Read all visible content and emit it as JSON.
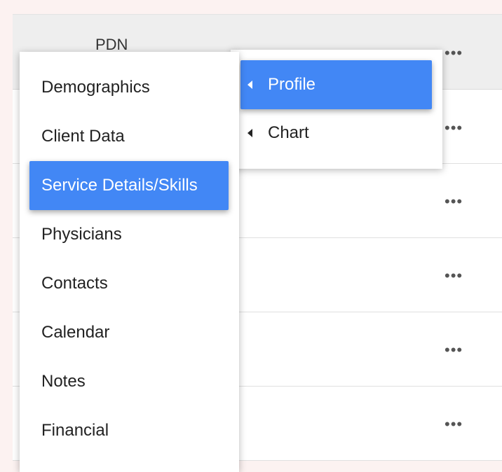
{
  "table": {
    "header_label": "PDN",
    "row_action_glyph": "•••",
    "row_count": 6
  },
  "menu": {
    "items": [
      {
        "label": "Demographics"
      },
      {
        "label": "Client Data"
      },
      {
        "label": "Service Details/Skills",
        "active": true
      },
      {
        "label": "Physicians"
      },
      {
        "label": "Contacts"
      },
      {
        "label": "Calendar"
      },
      {
        "label": "Notes"
      },
      {
        "label": "Financial"
      }
    ]
  },
  "submenu": {
    "items": [
      {
        "label": "Profile",
        "active": true,
        "icon": "caret-left-icon"
      },
      {
        "label": "Chart",
        "icon": "caret-left-icon"
      }
    ]
  },
  "colors": {
    "accent": "#4287f5",
    "page_bg": "#fcf2f1",
    "header_bg": "#eeeeee"
  }
}
